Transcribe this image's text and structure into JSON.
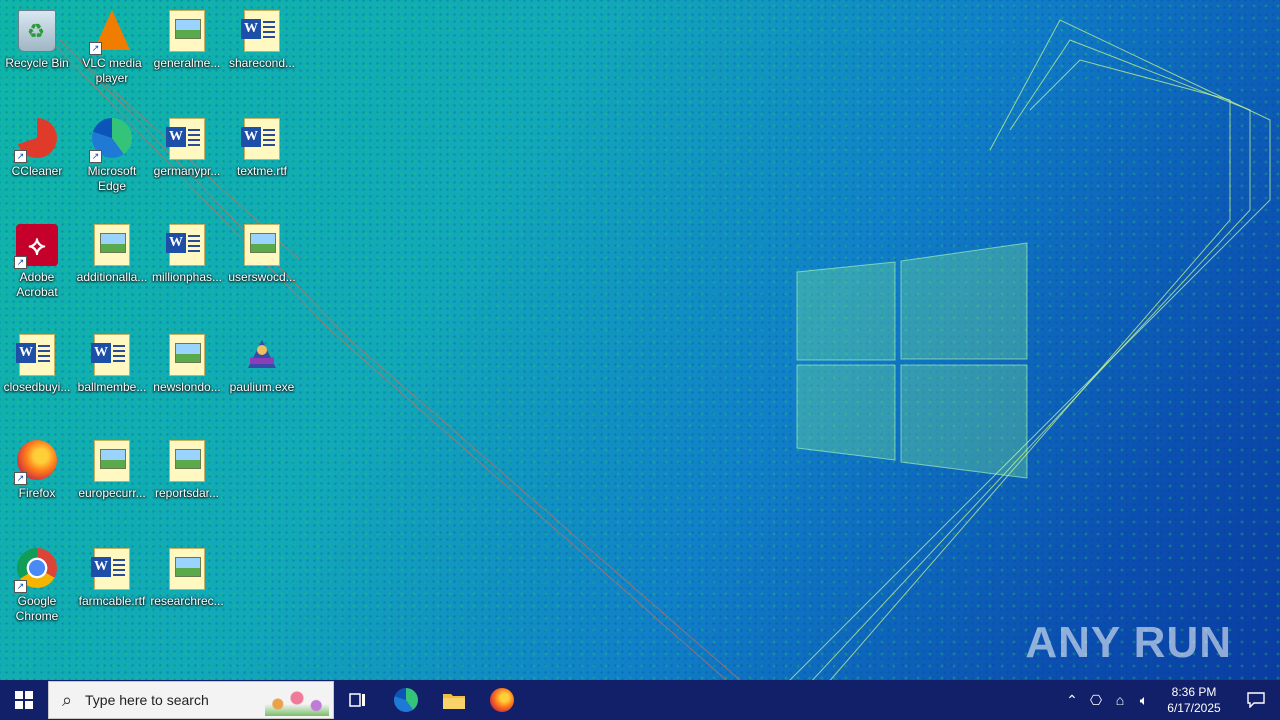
{
  "desktop": {
    "icons": [
      {
        "label": "Recycle Bin",
        "type": "recycle-bin-icon"
      },
      {
        "label": "VLC media player",
        "type": "vlc-icon"
      },
      {
        "label": "generalme...",
        "type": "image-file-icon"
      },
      {
        "label": "sharecond...",
        "type": "word-doc-icon"
      },
      {
        "label": "CCleaner",
        "type": "ccleaner-icon"
      },
      {
        "label": "Microsoft Edge",
        "type": "edge-icon"
      },
      {
        "label": "germanypr...",
        "type": "word-doc-icon"
      },
      {
        "label": "textme.rtf",
        "type": "word-doc-icon"
      },
      {
        "label": "Adobe Acrobat",
        "type": "acrobat-icon"
      },
      {
        "label": "additionalla...",
        "type": "image-file-icon"
      },
      {
        "label": "millionphas...",
        "type": "word-doc-icon"
      },
      {
        "label": "userswocd...",
        "type": "image-file-icon"
      },
      {
        "label": "closedbuyi...",
        "type": "word-doc-icon"
      },
      {
        "label": "ballmembe...",
        "type": "word-doc-icon"
      },
      {
        "label": "newslondo...",
        "type": "image-file-icon"
      },
      {
        "label": "paulium.exe",
        "type": "exe-icon"
      },
      {
        "label": "Firefox",
        "type": "firefox-icon"
      },
      {
        "label": "europecurr...",
        "type": "image-file-icon"
      },
      {
        "label": "reportsdar...",
        "type": "image-file-icon"
      },
      {
        "label": "Google Chrome",
        "type": "chrome-icon"
      },
      {
        "label": "farmcable.rtf",
        "type": "word-doc-icon"
      },
      {
        "label": "researchrec...",
        "type": "image-file-icon"
      }
    ],
    "watermark": "ANY RUN"
  },
  "taskbar": {
    "search_placeholder": "Type here to search",
    "pinned": [
      "task-view-icon",
      "edge-icon",
      "file-explorer-icon",
      "firefox-icon"
    ],
    "tray": {
      "time": "8:36 PM",
      "date": "6/17/2025"
    }
  }
}
